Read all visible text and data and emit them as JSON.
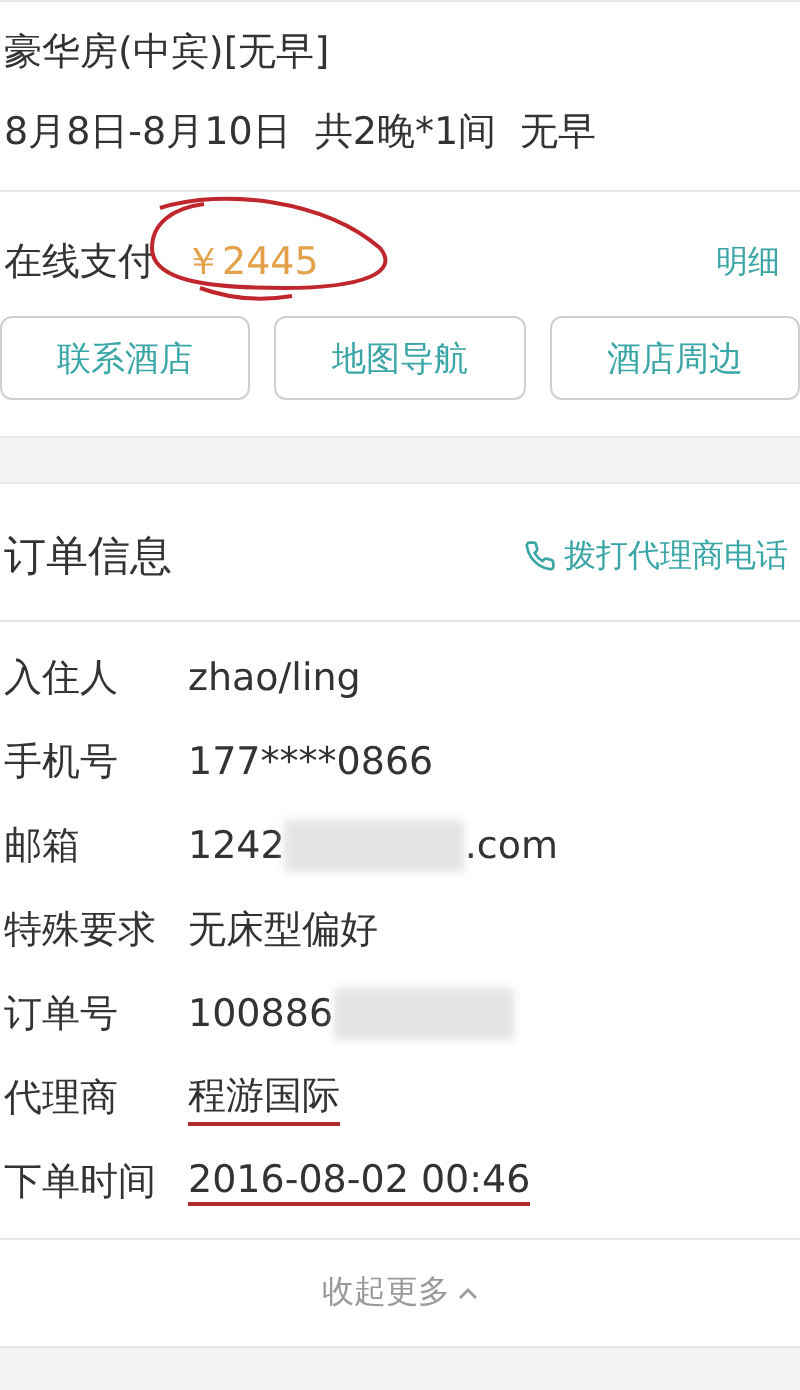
{
  "room": {
    "name": "豪华房(中宾)[无早]",
    "stay": "8月8日-8月10日  共2晚*1间  无早"
  },
  "payment": {
    "label": "在线支付",
    "price": "￥2445",
    "detail_link": "明细"
  },
  "actions": [
    "联系酒店",
    "地图导航",
    "酒店周边"
  ],
  "order": {
    "title": "订单信息",
    "call_link": "拨打代理商电话",
    "rows": [
      {
        "label": "入住人",
        "value": "zhao/ling",
        "underlined": false
      },
      {
        "label": "手机号",
        "value": "177****0866",
        "underlined": false
      },
      {
        "label": "邮箱",
        "value": "1242",
        "suffix": ".com",
        "underlined": false
      },
      {
        "label": "特殊要求",
        "value": "无床型偏好",
        "underlined": false
      },
      {
        "label": "订单号",
        "value": "100886",
        "underlined": false,
        "redacted": true
      },
      {
        "label": "代理商",
        "value": "程游国际",
        "underlined": true
      },
      {
        "label": "下单时间",
        "value": "2016-08-02 00:46",
        "underlined": true
      }
    ],
    "collapse": "收起更多"
  }
}
